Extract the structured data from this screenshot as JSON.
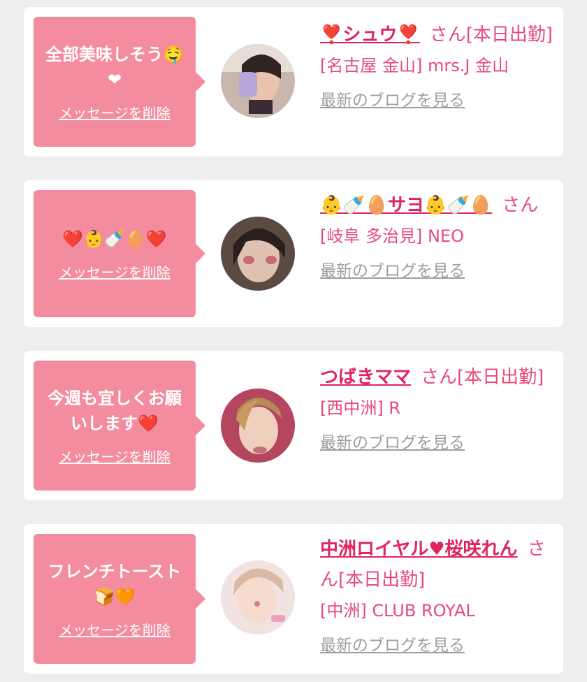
{
  "items": [
    {
      "message": "全部美味しそう🤤❤",
      "delete_label": "メッセージを削除",
      "name": "❣️シュウ❣️",
      "suffix": "さん[本日出勤]",
      "shop": "[名古屋 金山] mrs.J 金山",
      "blog_label": "最新のブログを見る",
      "avatar": "avatar-photo-1"
    },
    {
      "message": "❤️👶🍼🥚❤️",
      "delete_label": "メッセージを削除",
      "name": "👶🍼🥚サヨ👶🍼🥚",
      "suffix": "さん",
      "shop": "[岐阜 多治見] NEO",
      "blog_label": "最新のブログを見る",
      "avatar": "avatar-photo-2"
    },
    {
      "message": "今週も宜しくお願いします❤️",
      "delete_label": "メッセージを削除",
      "name": "つばきママ",
      "suffix": "さん[本日出勤]",
      "shop": "[西中洲] R",
      "blog_label": "最新のブログを見る",
      "avatar": "avatar-photo-3"
    },
    {
      "message": "フレンチトースト🍞🧡",
      "delete_label": "メッセージを削除",
      "name": "中洲ロイヤル♥桜咲れん",
      "suffix": "さん[本日出勤]",
      "shop": "[中洲] CLUB ROYAL",
      "blog_label": "最新のブログを見る",
      "avatar": "avatar-photo-4"
    }
  ]
}
